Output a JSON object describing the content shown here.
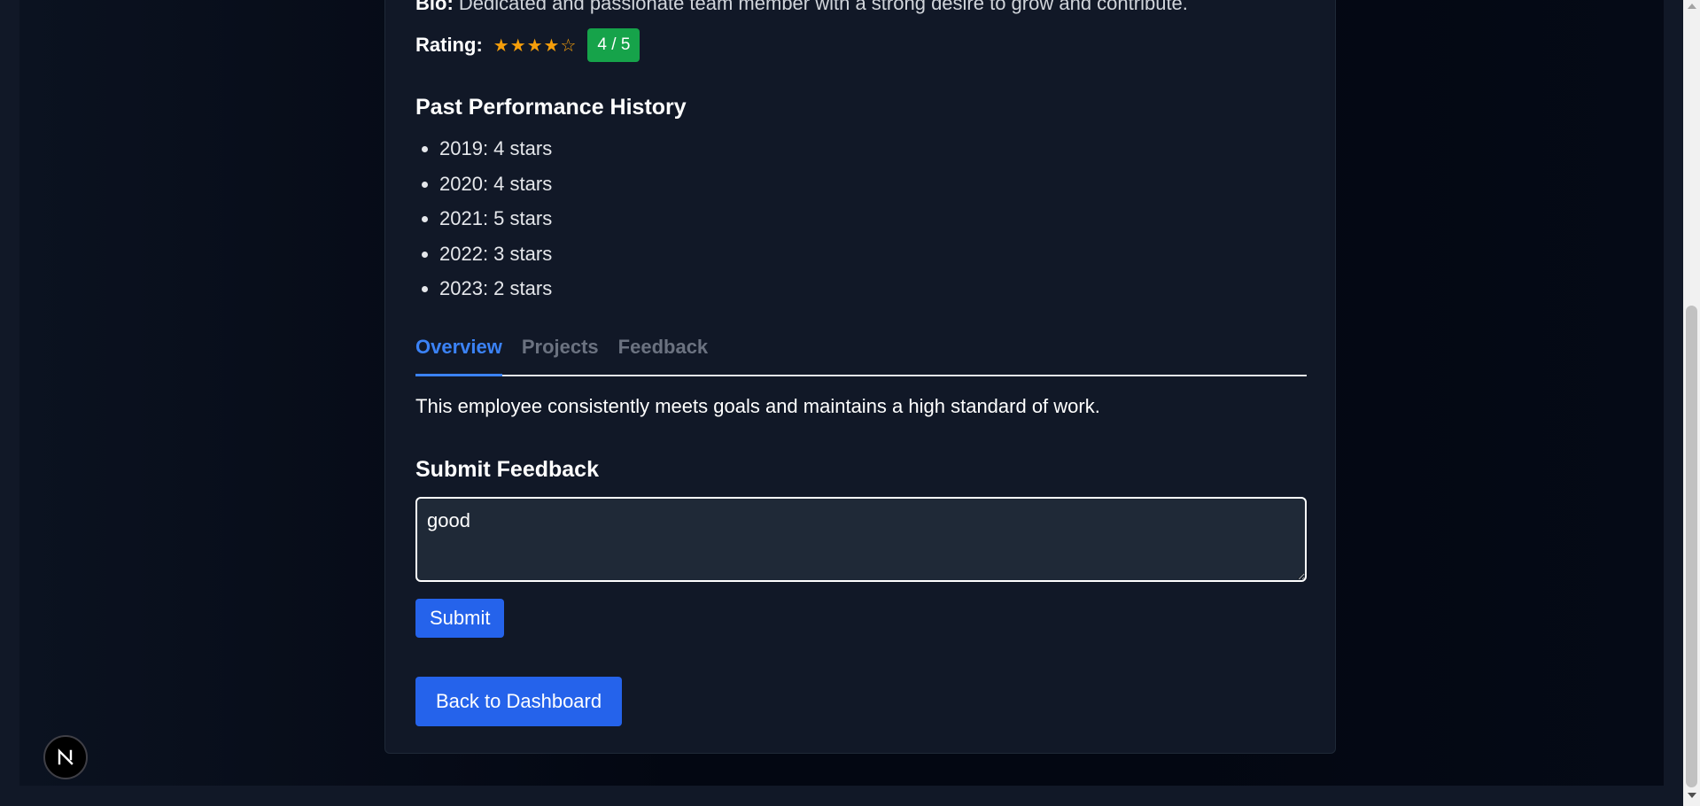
{
  "profile": {
    "bio_label": "Bio:",
    "bio_text": "Dedicated and passionate team member with a strong desire to grow and contribute.",
    "rating_label": "Rating:",
    "rating_stars": "★★★★☆",
    "rating_value": 4,
    "rating_max": 5,
    "rating_badge": "4 / 5"
  },
  "history": {
    "title": "Past Performance History",
    "items": [
      "2019: 4 stars",
      "2020: 4 stars",
      "2021: 5 stars",
      "2022: 3 stars",
      "2023: 2 stars"
    ]
  },
  "tabs": {
    "items": [
      "Overview",
      "Projects",
      "Feedback"
    ],
    "active": "Overview",
    "overview_text": "This employee consistently meets goals and maintains a high standard of work."
  },
  "feedback": {
    "title": "Submit Feedback",
    "value": "good",
    "submit_label": "Submit"
  },
  "navigation": {
    "back_label": "Back to Dashboard"
  },
  "dev_badge": {
    "icon": "nextjs-logo-icon",
    "letter": "N"
  },
  "colors": {
    "accent": "#2563eb",
    "tab_active": "#3b82f6",
    "badge_green": "#16a34a",
    "star": "#f59e0b",
    "card_bg": "#111827"
  }
}
